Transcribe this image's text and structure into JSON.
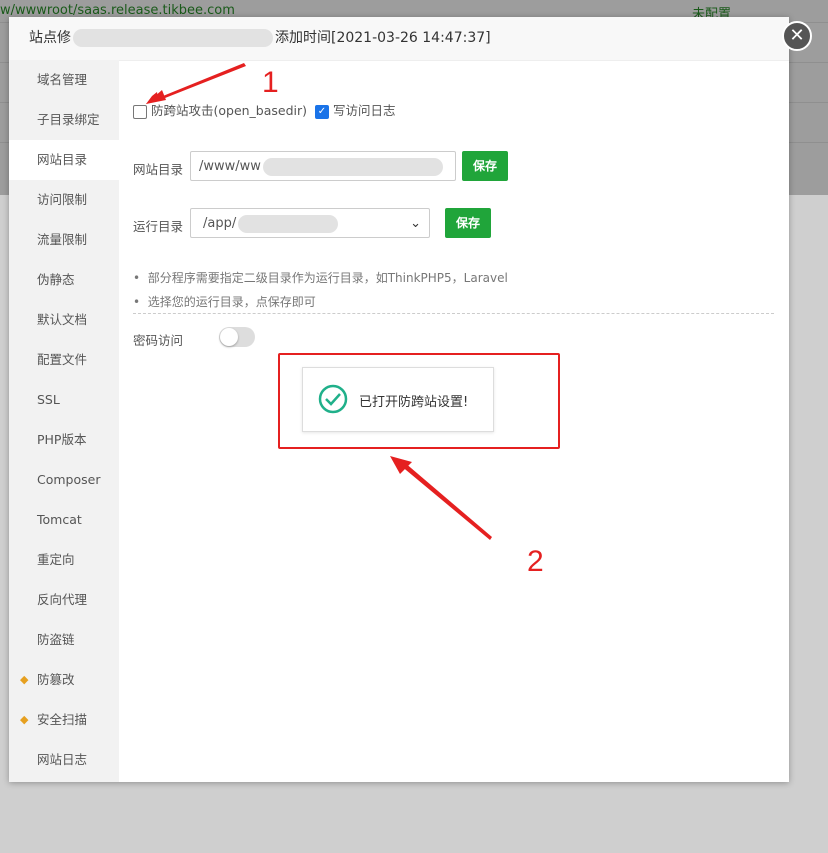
{
  "background": {
    "site_path": "w/wwwroot/saas.release.tikbee.com",
    "status": "未配置"
  },
  "dialog": {
    "title_prefix": "站点修",
    "title_suffix": "添加时间[2021-03-26 14:47:37]",
    "close_icon": "close-icon"
  },
  "sidebar": {
    "items": [
      {
        "label": "域名管理"
      },
      {
        "label": "子目录绑定"
      },
      {
        "label": "网站目录",
        "active": true
      },
      {
        "label": "访问限制"
      },
      {
        "label": "流量限制"
      },
      {
        "label": "伪静态"
      },
      {
        "label": "默认文档"
      },
      {
        "label": "配置文件"
      },
      {
        "label": "SSL"
      },
      {
        "label": "PHP版本"
      },
      {
        "label": "Composer"
      },
      {
        "label": "Tomcat"
      },
      {
        "label": "重定向"
      },
      {
        "label": "反向代理"
      },
      {
        "label": "防盗链"
      },
      {
        "label": "防篡改",
        "icon": "gem-icon"
      },
      {
        "label": "安全扫描",
        "icon": "gem-icon"
      },
      {
        "label": "网站日志"
      }
    ]
  },
  "main": {
    "anti_xss": {
      "label": "防跨站攻击(open_basedir)",
      "checked": false
    },
    "access_log": {
      "label": "写访问日志",
      "checked": true
    },
    "site_dir": {
      "label": "网站目录",
      "value": "/www/ww",
      "save": "保存"
    },
    "run_dir": {
      "label": "运行目录",
      "value": "/app/",
      "save": "保存"
    },
    "tips": [
      "部分程序需要指定二级目录作为运行目录，如ThinkPHP5，Laravel",
      "选择您的运行目录，点保存即可"
    ],
    "password_access": {
      "label": "密码访问",
      "enabled": false
    }
  },
  "toast": {
    "message": "已打开防跨站设置!"
  },
  "annotations": {
    "n1": "1",
    "n2": "2",
    "color": "#e52020"
  },
  "colors": {
    "accent": "#20a53a"
  }
}
